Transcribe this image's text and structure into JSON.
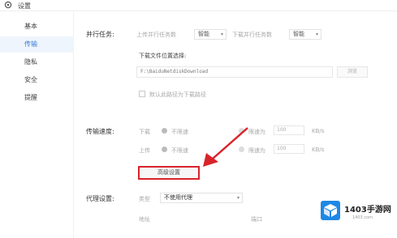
{
  "window": {
    "title": "设置",
    "icon": "gear-icon"
  },
  "sidebar": {
    "items": [
      {
        "label": "基本",
        "active": false
      },
      {
        "label": "传输",
        "active": true
      },
      {
        "label": "隐私",
        "active": false
      },
      {
        "label": "安全",
        "active": false
      },
      {
        "label": "提醒",
        "active": false
      }
    ]
  },
  "parallel": {
    "label": "并行任务:",
    "upload_label": "上传并行任务数",
    "upload_value": "智能",
    "download_label": "下载并行任务数",
    "download_value": "智能"
  },
  "download_location": {
    "label": "下载文件位置选择:",
    "path": "F:\\BaiduNetdiskDownload",
    "browse_label": "浏览",
    "default_checkbox_label": "默认此路径为下载路径"
  },
  "speed": {
    "label": "传输速度:",
    "download_label": "下载",
    "download_option": "不限速",
    "download_limit_label": "限速为",
    "download_limit_value": "100",
    "download_unit": "KB/s",
    "upload_label": "上传",
    "upload_option": "不限速",
    "upload_limit_label": "限速为",
    "upload_limit_value": "100",
    "upload_unit": "KB/s"
  },
  "advanced": {
    "button_label": "高级设置"
  },
  "proxy": {
    "label": "代理设置:",
    "type_label": "类型",
    "type_value": "不使用代理",
    "address_label": "地址",
    "port_label": "端口"
  },
  "watermark": {
    "text": "1403手游网",
    "sub": "1403.com"
  },
  "colors": {
    "accent": "#3a7bd5",
    "highlight": "#d9232a"
  }
}
